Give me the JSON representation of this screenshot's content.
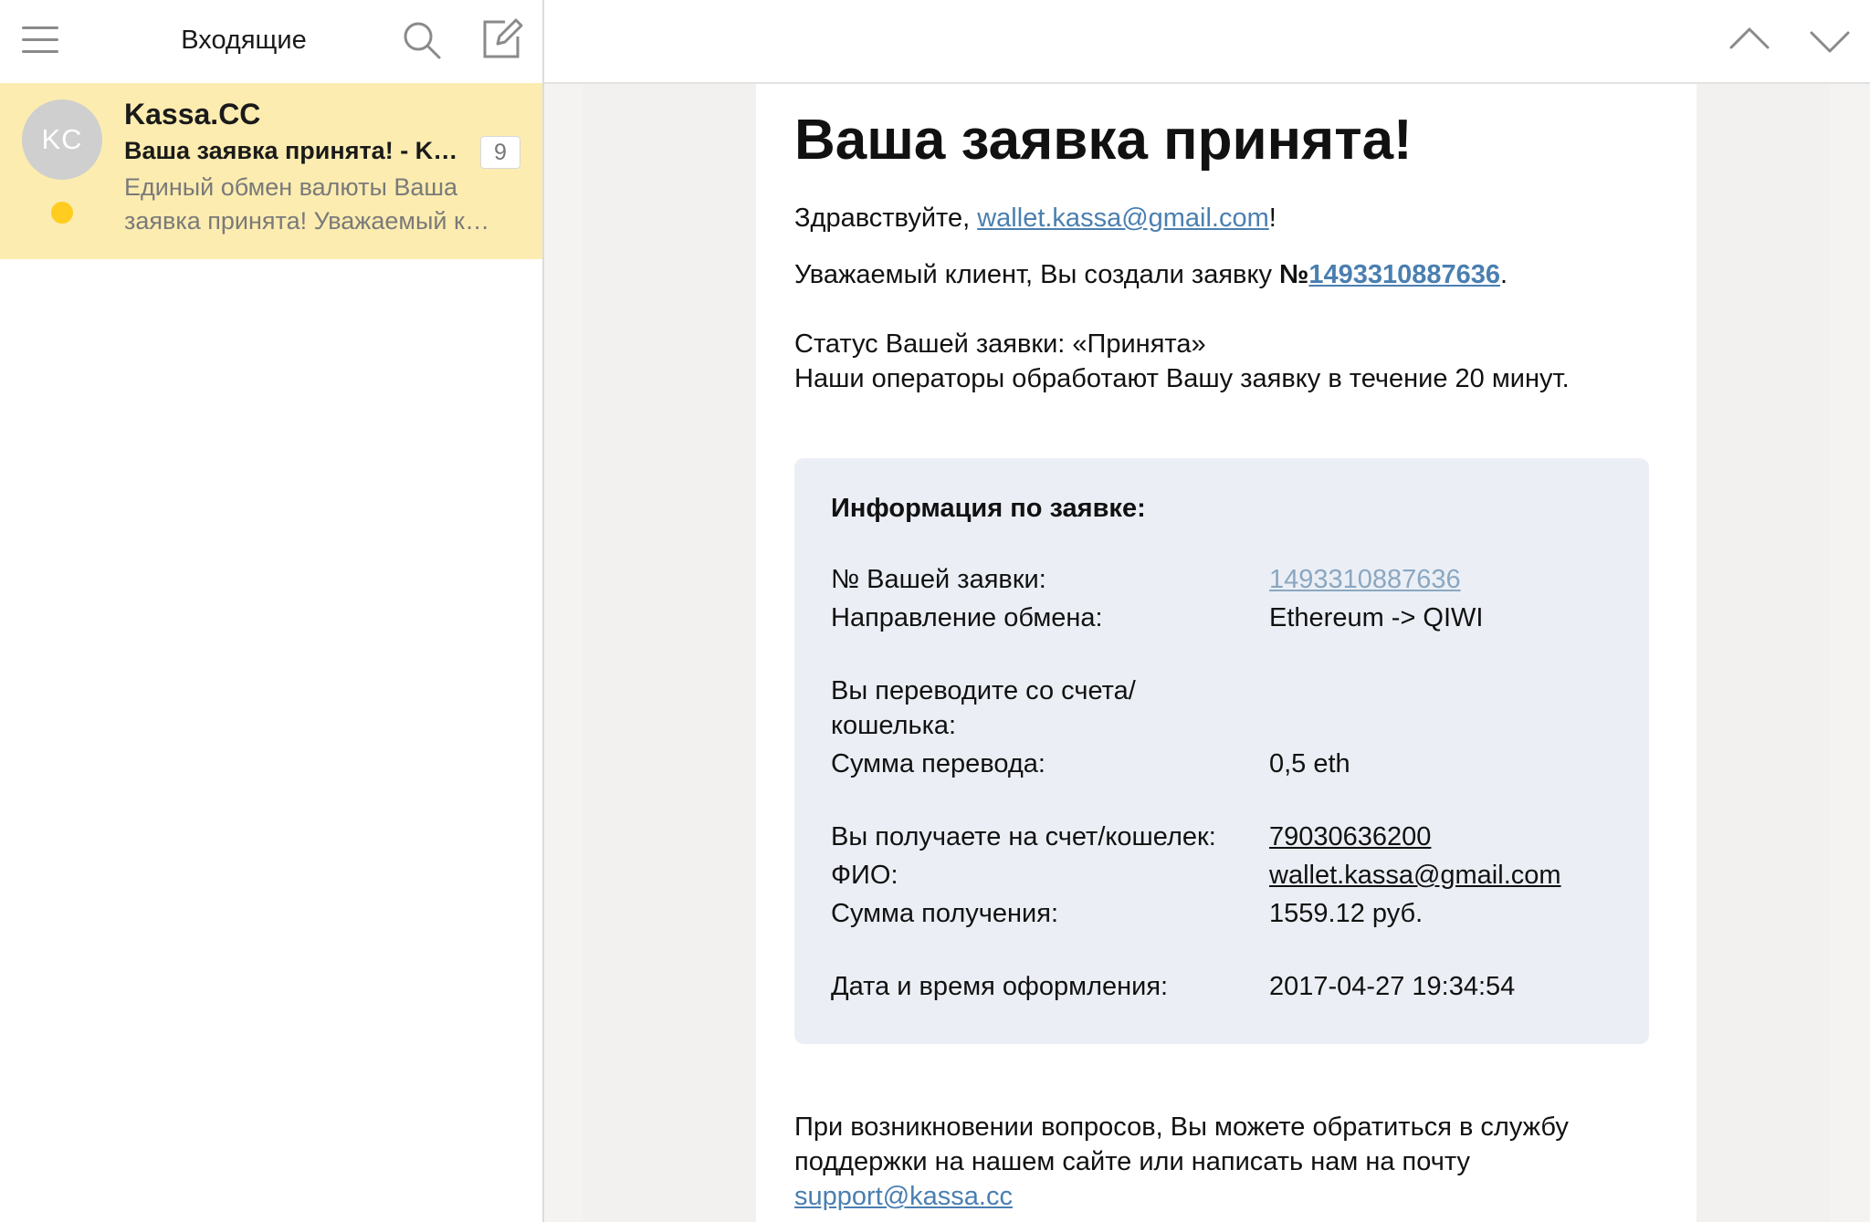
{
  "left_pane": {
    "folder_title": "Входящие",
    "message": {
      "avatar_initials": "KC",
      "sender": "Kassa.CC",
      "subject": "Ваша заявка принята! - Kassa.CC",
      "count": "9",
      "snippet_line1": " Единый обмен валюты Ваша",
      "snippet_line2": "заявка принята! Уважаемый клиент, Вы создали заявку"
    }
  },
  "email": {
    "title": "Ваша заявка принята!",
    "greeting_prefix": "Здравствуйте, ",
    "greeting_email": "wallet.kassa@gmail.com",
    "greeting_suffix": "!",
    "created_prefix": "Уважаемый клиент, Вы создали заявку ",
    "created_no_sign": "№",
    "created_order_number": "1493310887636",
    "created_suffix": ".",
    "status_line": "Статус Вашей заявки: «Принята»",
    "operators_line": "Наши операторы обработают Вашу заявку в течение 20 минут.",
    "info": {
      "heading": "Информация по заявке:",
      "order_label": "№ Вашей заявки:",
      "order_value": "1493310887636",
      "direction_label": "Направление обмена:",
      "direction_value": "Ethereum -> QIWI",
      "from_account_label_line1": "Вы переводите со счета/",
      "from_account_label_line2": "кошелька:",
      "amount_label": "Сумма перевода:",
      "amount_value": "0,5 eth",
      "to_account_label": "Вы получаете на счет/кошелек:",
      "to_account_value": "79030636200",
      "fio_label": "ФИО:",
      "fio_value": "wallet.kassa@gmail.com",
      "receive_label": "Сумма получения:",
      "receive_value": "1559.12 руб.",
      "date_label": "Дата и время оформления:",
      "date_value": "2017-04-27 19:34:54"
    },
    "support_line1": "При возникновении вопросов, Вы можете обратиться в службу",
    "support_line2": "поддержки на нашем сайте или написать нам на почту",
    "support_email": "support@kassa.cc"
  },
  "icons": {
    "menu": "menu-icon",
    "search": "search-icon",
    "compose": "compose-icon",
    "prev": "chevron-up-icon",
    "next": "chevron-down-icon"
  },
  "colors": {
    "selected_item_bg": "#fcecb0",
    "unread_dot": "#ffcc1f",
    "link": "#4a7fb0",
    "info_box_bg": "#ebeff5"
  }
}
